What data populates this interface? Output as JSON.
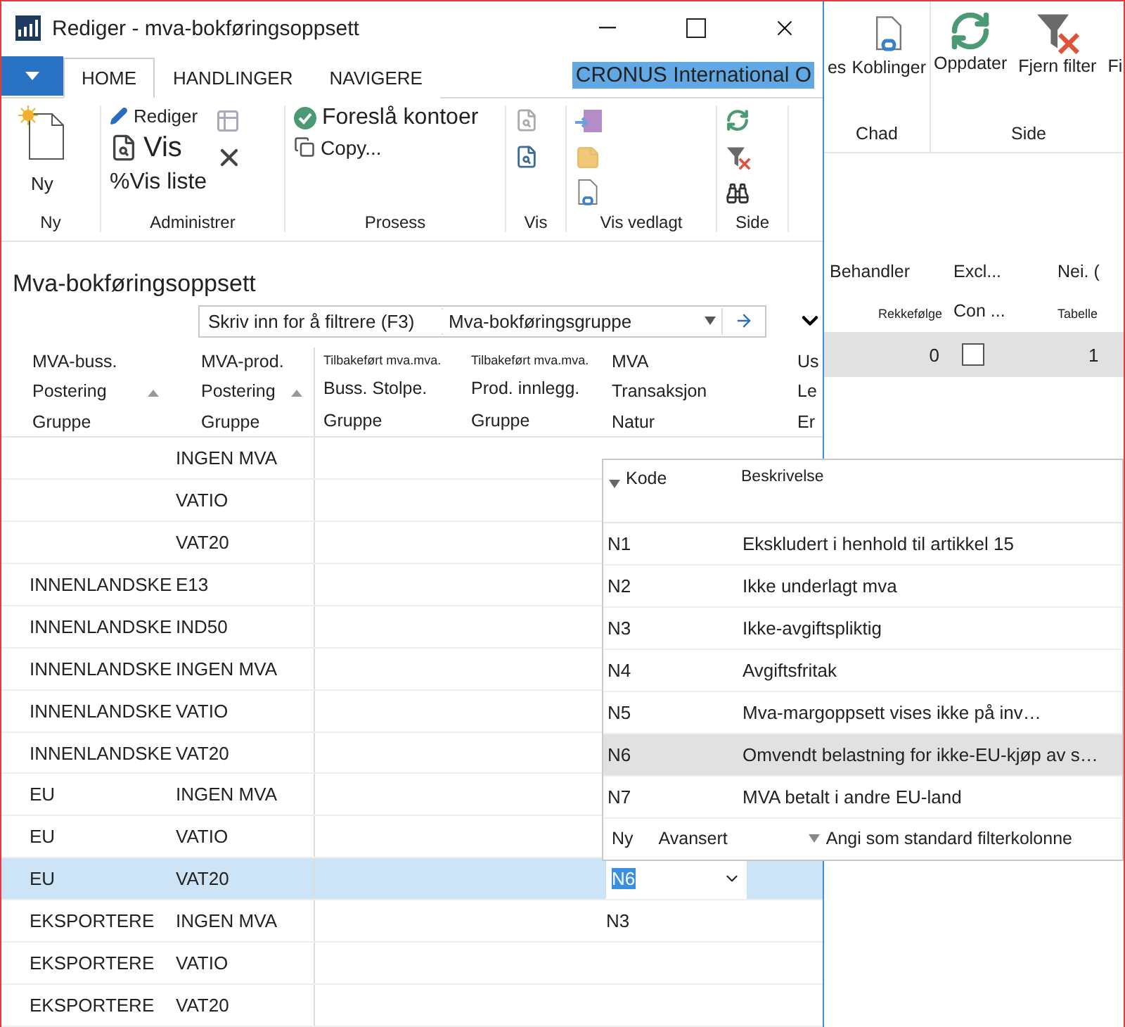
{
  "window": {
    "title": "Rediger - mva-bokføringsoppsett",
    "company": "CRONUS International O"
  },
  "tabs": [
    {
      "label": "HOME",
      "selected": true
    },
    {
      "label": "HANDLINGER",
      "selected": false
    },
    {
      "label": "NAVIGERE",
      "selected": false
    }
  ],
  "ribbon": {
    "new": {
      "action": "Ny",
      "group": "Ny"
    },
    "manage": {
      "actions": [
        "Rediger",
        "Vis",
        "%Vis liste"
      ],
      "group": "Administrer"
    },
    "process": {
      "actions": [
        "Foreslå kontoer",
        "Copy..."
      ],
      "group": "Prosess"
    },
    "view": {
      "group": "Vis"
    },
    "attached": {
      "group": "Vis vedlagt"
    },
    "page": {
      "group": "Side"
    }
  },
  "page_title": "Mva-bokføringsoppsett",
  "filter": {
    "placeholder": "Skriv inn for å filtrere (F3)",
    "field": "Mva-bokføringsgruppe"
  },
  "columns": [
    {
      "lines": [
        "MVA-buss.",
        "Postering",
        "Gruppe"
      ],
      "sort_indicator": true
    },
    {
      "lines": [
        "MVA-prod.",
        "Postering",
        "Gruppe"
      ],
      "sort_indicator": true
    },
    {
      "lines": [
        "Tilbakeført mva.mva.",
        "Buss. Stolpe.",
        "Gruppe"
      ],
      "sort_indicator": false
    },
    {
      "lines": [
        "Tilbakeført mva.mva.",
        "Prod. innlegg.",
        "Gruppe"
      ],
      "sort_indicator": false
    },
    {
      "lines": [
        "MVA",
        "Transaksjon",
        "Natur"
      ],
      "sort_indicator": false
    },
    {
      "lines": [
        "Us",
        "Le",
        "Er"
      ],
      "sort_indicator": false
    }
  ],
  "rows": [
    {
      "bus": "",
      "prod": "INGEN MVA",
      "selected": false
    },
    {
      "bus": "",
      "prod": "VATIO",
      "selected": false
    },
    {
      "bus": "",
      "prod": "VAT20",
      "selected": false
    },
    {
      "bus": "INNENLANDSKE",
      "prod": "E13",
      "selected": false
    },
    {
      "bus": "INNENLANDSKE",
      "prod": "IND50",
      "selected": false
    },
    {
      "bus": "INNENLANDSKE",
      "prod": "INGEN MVA",
      "selected": false
    },
    {
      "bus": "INNENLANDSKE",
      "prod": "VATIO",
      "selected": false
    },
    {
      "bus": "INNENLANDSKE",
      "prod": "VAT20",
      "selected": false
    },
    {
      "bus": "EU",
      "prod": "INGEN MVA",
      "selected": false
    },
    {
      "bus": "EU",
      "prod": "VATIO",
      "selected": false
    },
    {
      "bus": "EU",
      "prod": "VAT20",
      "nature": "N6",
      "selected": true
    },
    {
      "bus": "EKSPORTERE",
      "prod": "INGEN MVA",
      "nature": "N3",
      "selected": false
    },
    {
      "bus": "EKSPORTERE",
      "prod": "VATIO",
      "selected": false
    },
    {
      "bus": "EKSPORTERE",
      "prod": "VAT20",
      "selected": false
    }
  ],
  "lookup": {
    "columns": [
      "Kode",
      "Beskrivelse"
    ],
    "items": [
      {
        "code": "N1",
        "description": "Ekskludert i henhold til artikkel 15",
        "selected": false
      },
      {
        "code": "N2",
        "description": "Ikke underlagt mva",
        "selected": false
      },
      {
        "code": "N3",
        "description": "Ikke-avgiftspliktig",
        "selected": false
      },
      {
        "code": "N4",
        "description": "Avgiftsfritak",
        "selected": false
      },
      {
        "code": "N5",
        "description": "Mva-margoppsett vises ikke på inv…",
        "selected": false
      },
      {
        "code": "N6",
        "description": "Omvendt belastning for ikke-EU-kjøp av s…",
        "selected": true
      },
      {
        "code": "N7",
        "description": "MVA betalt i andre EU-land",
        "selected": false
      }
    ],
    "footer": [
      "Ny",
      "Avansert",
      "Angi som standard filterkolonne"
    ]
  },
  "background_window": {
    "ribbon": {
      "actions": [
        "es",
        "Koblinger",
        "Oppdater",
        "Fjern filter",
        "Fi"
      ],
      "groups": [
        "Chad",
        "Side"
      ]
    },
    "columns": [
      {
        "lines": [
          "Behandler",
          "Rekkefølge"
        ]
      },
      {
        "lines": [
          "Excl...",
          "Con ..."
        ]
      },
      {
        "lines": [
          "Nei. (",
          "Tabelle"
        ]
      }
    ],
    "row": {
      "order": "0",
      "checked": false,
      "number": "1",
      "selected": true
    }
  }
}
